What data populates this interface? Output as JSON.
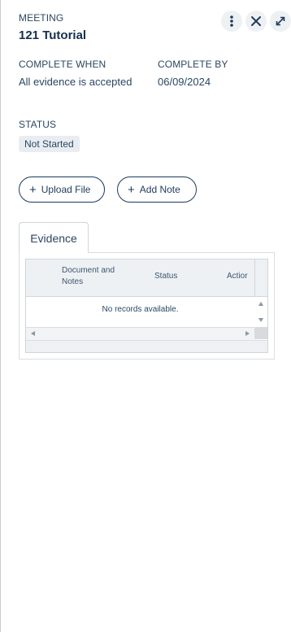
{
  "header": {
    "eyebrow": "MEETING",
    "title": "121 Tutorial",
    "actions": [
      "more-vertical-icon",
      "close-icon",
      "expand-icon"
    ]
  },
  "complete_when": {
    "label": "COMPLETE WHEN",
    "value": "All evidence is accepted"
  },
  "complete_by": {
    "label": "COMPLETE BY",
    "value": "06/09/2024"
  },
  "status": {
    "label": "STATUS",
    "value": "Not Started"
  },
  "buttons": {
    "upload_file": "Upload File",
    "add_note": "Add Note"
  },
  "tabs": [
    {
      "label": "Evidence",
      "active": true
    }
  ],
  "grid": {
    "columns": [
      {
        "line1": "Document and",
        "line2": "Notes"
      },
      {
        "line1": "Status"
      },
      {
        "line1": "Actior"
      }
    ],
    "empty_message": "No records available."
  },
  "colors": {
    "text": "#1f3a5a",
    "badge_bg": "#e9edf1",
    "grid_header_bg": "#eef1f4"
  }
}
